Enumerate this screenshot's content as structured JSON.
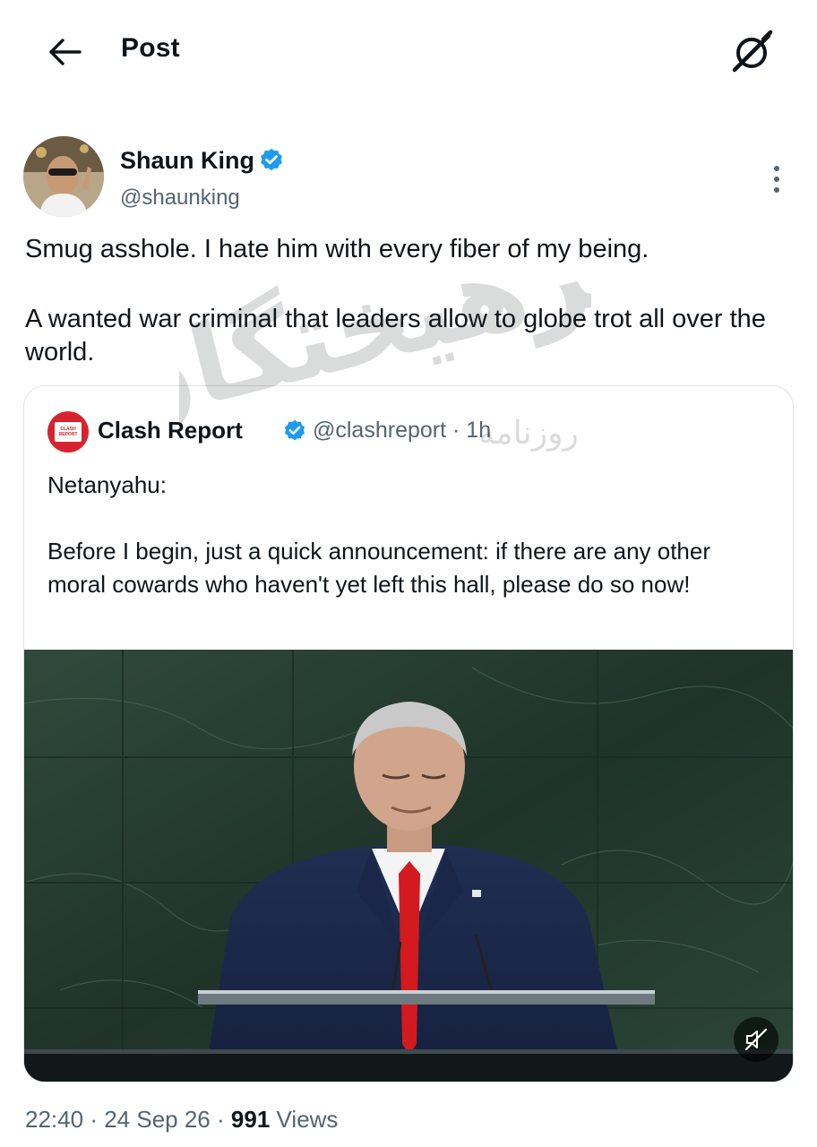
{
  "header": {
    "title": "Post"
  },
  "author": {
    "name": "Shaun King",
    "handle": "@shaunking"
  },
  "tweet": {
    "paragraphs": [
      "Smug asshole. I hate him with every fiber of my being.",
      "A wanted war criminal that leaders allow to globe trot all over the world."
    ]
  },
  "quote": {
    "name": "Clash Report",
    "handle": "@clashreport",
    "separator": "·",
    "time": "1h",
    "logo_text": [
      "CLASH",
      "REPORT"
    ],
    "paragraphs": [
      "Netanyahu:",
      "Before I begin, just a quick announcement: if there are any other moral cowards who haven't yet left this hall, please do so now!"
    ]
  },
  "meta": {
    "time": "22:40",
    "date": "24 Sep 26",
    "sep": "·",
    "views_count": "991",
    "views_label": "Views"
  },
  "watermark": {
    "line1": "فرهیختگان",
    "line2": "روزنامه"
  },
  "colors": {
    "verified": "#1d9bf0",
    "clash_red": "#d6232d",
    "text": "#0f1419",
    "secondary": "#536471",
    "border": "#dfe3e7"
  },
  "icons": {
    "back": "arrow-left-icon",
    "grok": "grok-slash-icon",
    "more": "more-vertical-icon",
    "verified": "verified-badge-icon",
    "mute": "volume-muted-icon"
  }
}
